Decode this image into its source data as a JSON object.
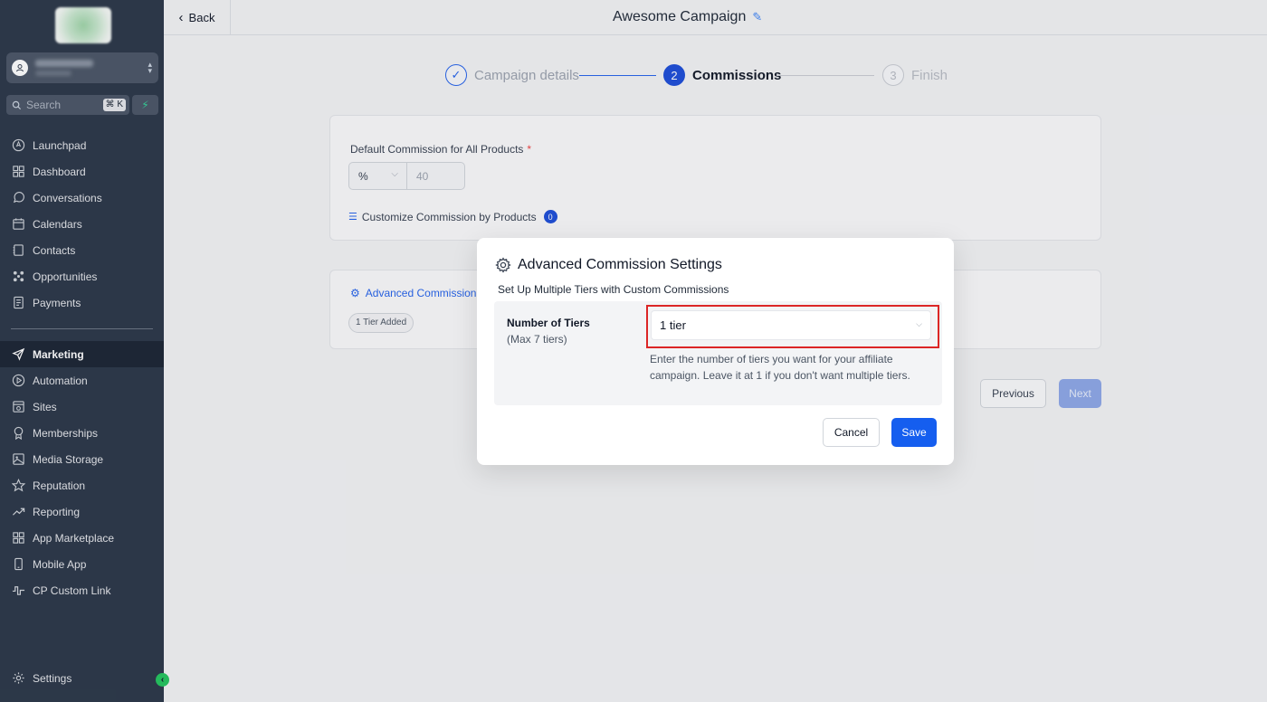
{
  "sidebar": {
    "search": {
      "placeholder": "Search",
      "shortcut": "⌘ K"
    },
    "items": [
      {
        "label": "Launchpad",
        "icon": "rocket-icon"
      },
      {
        "label": "Dashboard",
        "icon": "dashboard-icon"
      },
      {
        "label": "Conversations",
        "icon": "chat-icon"
      },
      {
        "label": "Calendars",
        "icon": "calendar-icon"
      },
      {
        "label": "Contacts",
        "icon": "contacts-icon"
      },
      {
        "label": "Opportunities",
        "icon": "opportunities-icon"
      },
      {
        "label": "Payments",
        "icon": "payments-icon"
      }
    ],
    "items2": [
      {
        "label": "Marketing",
        "icon": "send-icon"
      },
      {
        "label": "Automation",
        "icon": "automation-icon"
      },
      {
        "label": "Sites",
        "icon": "sites-icon"
      },
      {
        "label": "Memberships",
        "icon": "award-icon"
      },
      {
        "label": "Media Storage",
        "icon": "image-icon"
      },
      {
        "label": "Reputation",
        "icon": "star-icon"
      },
      {
        "label": "Reporting",
        "icon": "trend-icon"
      },
      {
        "label": "App Marketplace",
        "icon": "grid-icon"
      },
      {
        "label": "Mobile App",
        "icon": "phone-icon"
      },
      {
        "label": "CP Custom Link",
        "icon": "pulse-icon"
      }
    ],
    "settings_label": "Settings",
    "active_item": "Marketing"
  },
  "header": {
    "back_label": "Back",
    "campaign_title": "Awesome Campaign"
  },
  "stepper": {
    "steps": [
      {
        "number": "✓",
        "label": "Campaign details",
        "state": "done"
      },
      {
        "number": "2",
        "label": "Commissions",
        "state": "active"
      },
      {
        "number": "3",
        "label": "Finish",
        "state": "pending"
      }
    ]
  },
  "commission_card": {
    "default_label": "Default Commission for All Products",
    "required_mark": "*",
    "type_value": "%",
    "amount_placeholder": "40",
    "customize_label": "Customize Commission by Products",
    "customize_count": "0"
  },
  "advanced_card": {
    "link_label": "Advanced Commission",
    "tier_badge": "1 Tier Added"
  },
  "footer": {
    "previous_label": "Previous",
    "next_label": "Next"
  },
  "modal": {
    "title": "Advanced Commission Settings",
    "subtitle": "Set Up Multiple Tiers with Custom Commissions",
    "tiers_label": "Number of Tiers",
    "tiers_hint": "(Max 7 tiers)",
    "tiers_value": "1 tier",
    "help_text": "Enter the number of tiers you want for your affiliate campaign. Leave it at 1 if you don't want multiple tiers.",
    "cancel_label": "Cancel",
    "save_label": "Save"
  },
  "colors": {
    "sidebar_bg": "#2b3748",
    "primary": "#155eef",
    "highlight": "#dc2626"
  }
}
